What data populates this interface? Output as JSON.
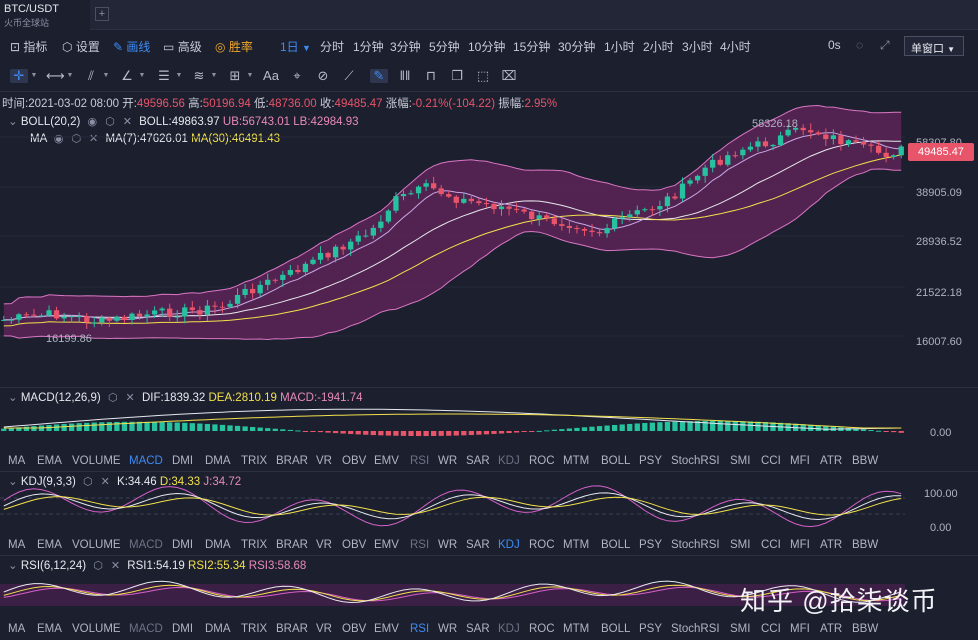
{
  "tab": {
    "symbol": "BTC/USDT",
    "exchange": "火币全球站",
    "add": "+"
  },
  "toolbar": {
    "indicators": "指标",
    "settings": "设置",
    "draw": "画线",
    "advanced": "高级",
    "winrate": "胜率",
    "interval_selected": "1日",
    "intervals": [
      "分时",
      "1分钟",
      "3分钟",
      "5分钟",
      "10分钟",
      "15分钟",
      "30分钟",
      "1小时",
      "2小时",
      "3小时",
      "4小时"
    ],
    "seconds": "0s",
    "window_mode": "单窗口"
  },
  "ohlc": {
    "time_label": "时间:",
    "time": "2021-03-02 08:00",
    "open_label": "开:",
    "open": "49596.56",
    "high_label": "高:",
    "high": "50196.94",
    "low_label": "低:",
    "low": "48736.00",
    "close_label": "收:",
    "close": "49485.47",
    "change_label": "涨幅:",
    "change": "-0.21%(-104.22)",
    "amp_label": "振幅:",
    "amp": "2.95%"
  },
  "main_legend": {
    "boll_name": "BOLL(20,2)",
    "boll": "BOLL:49863.97",
    "ub": "UB:56743.01",
    "lb": "LB:42984.93",
    "ma_name": "MA",
    "ma7": "MA(7):47626.01",
    "ma30": "MA(30):46491.43"
  },
  "price_axis": [
    "58307.80",
    "38905.09",
    "28936.52",
    "21522.18",
    "16007.60"
  ],
  "current_price": "49485.47",
  "annotations": {
    "high": "58326.18",
    "low": "16199.86"
  },
  "macd_legend": {
    "name": "MACD(12,26,9)",
    "dif": "DIF:1839.32",
    "dea": "DEA:2810.19",
    "macd": "MACD:-1941.74"
  },
  "macd_axis": [
    "0.00"
  ],
  "kdj_legend": {
    "name": "KDJ(9,3,3)",
    "k": "K:34.46",
    "d": "D:34.33",
    "j": "J:34.72"
  },
  "kdj_axis": [
    "100.00",
    "0.00"
  ],
  "rsi_legend": {
    "name": "RSI(6,12,24)",
    "r1": "RSI1:54.19",
    "r2": "RSI2:55.34",
    "r3": "RSI3:58.68"
  },
  "indicator_list": [
    "MA",
    "EMA",
    "VOLUME",
    "MACD",
    "DMI",
    "DMA",
    "TRIX",
    "BRAR",
    "VR",
    "OBV",
    "EMV",
    "RSI",
    "WR",
    "SAR",
    "KDJ",
    "ROC",
    "MTM",
    "BOLL",
    "PSY",
    "StochRSI",
    "SMI",
    "CCI",
    "MFI",
    "ATR",
    "BBW"
  ],
  "watermark": "知乎 @拾柒谈币",
  "colors": {
    "up": "#26c2a0",
    "down": "#e8546a",
    "boll_fill": "#5c2456",
    "accent": "#3d8cf4",
    "ma30": "#f2e14c",
    "ma7": "#e88ab8"
  }
}
